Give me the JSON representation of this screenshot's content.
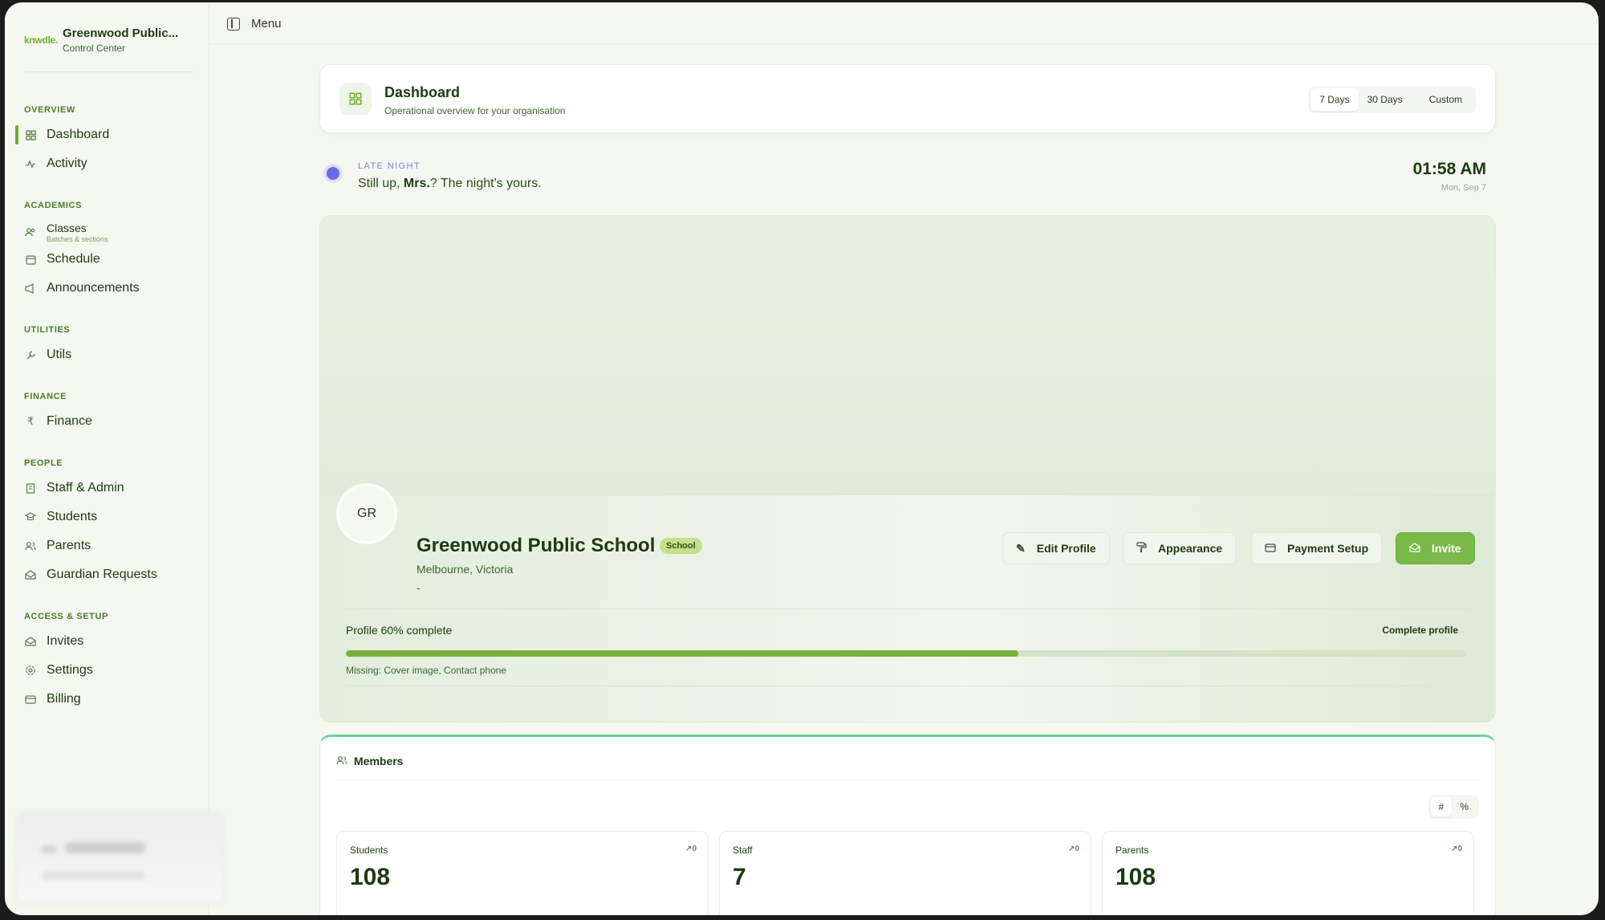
{
  "brand": {
    "logo": "knwdle.",
    "title": "Greenwood Public...",
    "subtitle": "Control Center"
  },
  "sidebar": {
    "sections": {
      "overview": "OVERVIEW",
      "academics": "ACADEMICS",
      "utilities": "UTILITIES",
      "finance": "FINANCE",
      "people": "PEOPLE",
      "access": "ACCESS & SETUP"
    },
    "items": {
      "dashboard": "Dashboard",
      "activity": "Activity",
      "classes": "Classes",
      "classes_sub": "Batches & sections",
      "schedule": "Schedule",
      "announcements": "Announcements",
      "utils": "Utils",
      "finance": "Finance",
      "staff": "Staff & Admin",
      "students": "Students",
      "parents": "Parents",
      "guardian": "Guardian Requests",
      "invites": "Invites",
      "settings": "Settings",
      "billing": "Billing"
    },
    "active": "dashboard"
  },
  "topbar": {
    "menu_label": "Menu"
  },
  "dashboard": {
    "title": "Dashboard",
    "subtitle": "Operational overview for your organisation",
    "ranges": [
      "7 Days",
      "30 Days"
    ],
    "custom": "Custom",
    "selected_range": "7 Days"
  },
  "greeting": {
    "tag": "LATE NIGHT",
    "prefix": "Still up, ",
    "name": "Mrs.",
    "suffix": "? The night's yours.",
    "time": "01:58 AM",
    "date": "Mon, Sep 7"
  },
  "profile": {
    "initials": "GR",
    "name": "Greenwood Public School",
    "badge": "School",
    "location": "Melbourne, Victoria",
    "extra": "-",
    "actions": {
      "edit": "Edit Profile",
      "appearance": "Appearance",
      "payment": "Payment Setup",
      "invite": "Invite"
    },
    "completion_label": "Profile 60% complete",
    "completion_percent": 60,
    "complete_link": "Complete profile",
    "missing": "Missing: Cover image, Contact phone"
  },
  "members": {
    "title": "Members",
    "toggle": [
      "#",
      "%"
    ],
    "stats": [
      {
        "label": "Students",
        "trend": "0",
        "value": "108"
      },
      {
        "label": "Staff",
        "trend": "0",
        "value": "7"
      },
      {
        "label": "Parents",
        "trend": "0",
        "value": "108"
      }
    ]
  },
  "colors": {
    "accent": "#6fae2c",
    "primary_button": "#79b94a",
    "greeting_dot": "#6b6be6",
    "members_border": "#6fd0a0"
  }
}
